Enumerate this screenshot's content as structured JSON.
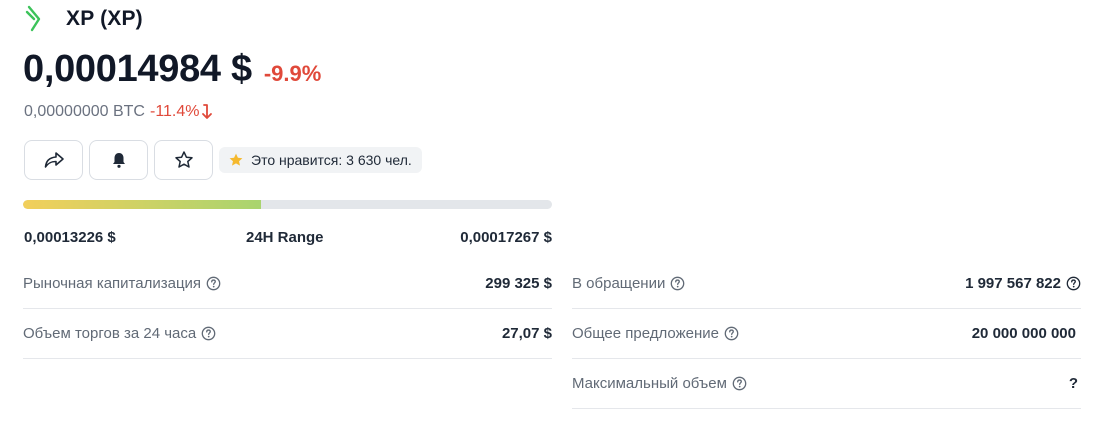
{
  "coin": {
    "title": "XP (XP)",
    "price": "0,00014984 $",
    "change_24h": "-9.9%",
    "btc_price": "0,00000000 BTC",
    "btc_change": "-11.4%",
    "likes_text": "Это нравится: 3 630 чел."
  },
  "range": {
    "low": "0,00013226 $",
    "label": "24H Range",
    "high": "0,00017267 $",
    "position_percent": 45
  },
  "stats_left": [
    {
      "label": "Рыночная капитализация",
      "value": "299 325 $"
    },
    {
      "label": "Объем торгов за 24 часа",
      "value": "27,07 $"
    }
  ],
  "stats_right": [
    {
      "label": "В обращении",
      "value": "1 997 567 822"
    },
    {
      "label": "Общее предложение",
      "value": "20 000 000 000"
    },
    {
      "label": "Максимальный объем",
      "value": "?"
    }
  ],
  "icons": {
    "logo": "chevron-logo-icon",
    "share": "share-icon",
    "alert": "bell-icon",
    "watchlist": "star-outline-icon",
    "likes": "star-filled-icon",
    "help": "question-circle-icon",
    "down": "arrow-down-icon"
  },
  "colors": {
    "negative": "#e0493a",
    "logo_green": "#3cc35a",
    "range_start": "#f2cf5b",
    "range_end": "#a9d46f",
    "star_yellow": "#f5b92e"
  }
}
